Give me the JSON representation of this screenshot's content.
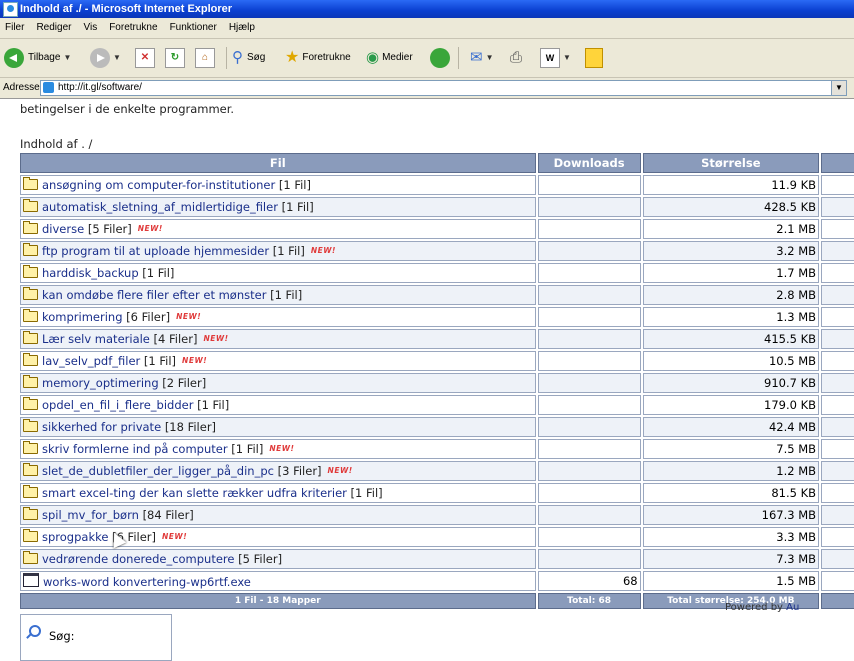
{
  "window": {
    "title": "Indhold af ./ - Microsoft Internet Explorer"
  },
  "menu": [
    "Filer",
    "Rediger",
    "Vis",
    "Foretrukne",
    "Funktioner",
    "Hjælp"
  ],
  "toolbar": {
    "back_label": "Tilbage",
    "search_label": "Søg",
    "favorites_label": "Foretrukne",
    "media_label": "Medier"
  },
  "address": {
    "label": "Adresse",
    "url": "http://it.gl/software/"
  },
  "page": {
    "intro": "betingelser i de enkelte programmer.",
    "heading": "Indhold af . /",
    "columns": {
      "file": "Fil",
      "downloads": "Downloads",
      "size": "Størrelse"
    },
    "new_badge": "NEW!",
    "rows": [
      {
        "name": "ansøgning om computer-for-institutioner",
        "count": "[1 Fil]",
        "size": "11.9 KB",
        "downloads": "",
        "new": false,
        "type": "folder"
      },
      {
        "name": "automatisk_sletning_af_midlertidige_filer",
        "count": "[1 Fil]",
        "size": "428.5 KB",
        "downloads": "",
        "new": false,
        "type": "folder"
      },
      {
        "name": "diverse",
        "count": "[5 Filer]",
        "size": "2.1 MB",
        "downloads": "",
        "new": true,
        "type": "folder"
      },
      {
        "name": "ftp program til at uploade hjemmesider",
        "count": "[1 Fil]",
        "size": "3.2 MB",
        "downloads": "",
        "new": true,
        "type": "folder"
      },
      {
        "name": "harddisk_backup",
        "count": "[1 Fil]",
        "size": "1.7 MB",
        "downloads": "",
        "new": false,
        "type": "folder"
      },
      {
        "name": "kan omdøbe flere filer efter et mønster",
        "count": "[1 Fil]",
        "size": "2.8 MB",
        "downloads": "",
        "new": false,
        "type": "folder"
      },
      {
        "name": "komprimering",
        "count": "[6 Filer]",
        "size": "1.3 MB",
        "downloads": "",
        "new": true,
        "type": "folder"
      },
      {
        "name": "Lær selv materiale",
        "count": "[4 Filer]",
        "size": "415.5 KB",
        "downloads": "",
        "new": true,
        "type": "folder"
      },
      {
        "name": "lav_selv_pdf_filer",
        "count": "[1 Fil]",
        "size": "10.5 MB",
        "downloads": "",
        "new": true,
        "type": "folder"
      },
      {
        "name": "memory_optimering",
        "count": "[2 Filer]",
        "size": "910.7 KB",
        "downloads": "",
        "new": false,
        "type": "folder"
      },
      {
        "name": "opdel_en_fil_i_flere_bidder",
        "count": "[1 Fil]",
        "size": "179.0 KB",
        "downloads": "",
        "new": false,
        "type": "folder"
      },
      {
        "name": "sikkerhed for private",
        "count": "[18 Filer]",
        "size": "42.4 MB",
        "downloads": "",
        "new": false,
        "type": "folder"
      },
      {
        "name": "skriv formlerne ind på computer",
        "count": "[1 Fil]",
        "size": "7.5 MB",
        "downloads": "",
        "new": true,
        "type": "folder"
      },
      {
        "name": "slet_de_dubletfiler_der_ligger_på_din_pc",
        "count": "[3 Filer]",
        "size": "1.2 MB",
        "downloads": "",
        "new": true,
        "type": "folder"
      },
      {
        "name": "smart excel-ting der kan slette rækker udfra kriterier",
        "count": "[1 Fil]",
        "size": "81.5 KB",
        "downloads": "",
        "new": false,
        "type": "folder"
      },
      {
        "name": "spil_mv_for_børn",
        "count": "[84 Filer]",
        "size": "167.3 MB",
        "downloads": "",
        "new": false,
        "type": "folder"
      },
      {
        "name": "sprogpakke",
        "count": "[6 Filer]",
        "size": "3.3 MB",
        "downloads": "",
        "new": true,
        "type": "folder"
      },
      {
        "name": "vedrørende donerede_computere",
        "count": "[5 Filer]",
        "size": "7.3 MB",
        "downloads": "",
        "new": false,
        "type": "folder"
      },
      {
        "name": "works-word konvertering-wp6rtf.exe",
        "count": "",
        "size": "1.5 MB",
        "downloads": "68",
        "new": false,
        "type": "file"
      }
    ],
    "footer": {
      "summary": "1 Fil - 18 Mapper",
      "total": "Total: 68",
      "total_size": "Total størrelse: 254.0 MB"
    },
    "powered_by": "Powered by",
    "powered_link": "Au",
    "search_label": "Søg:"
  }
}
